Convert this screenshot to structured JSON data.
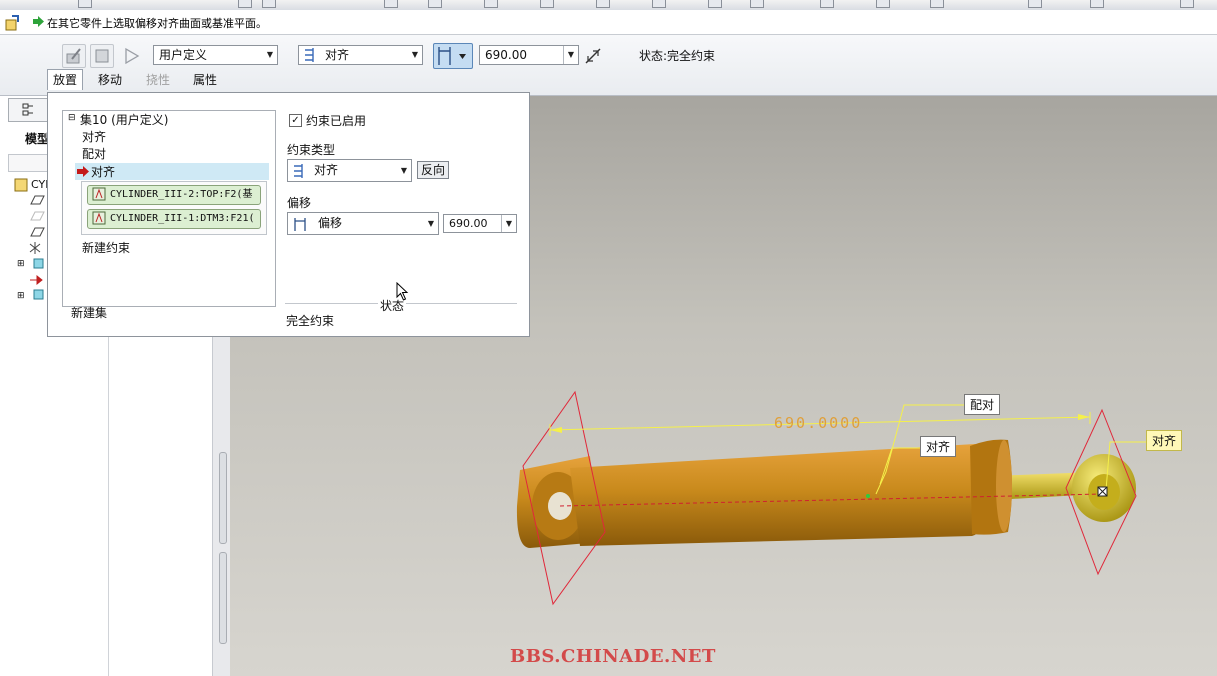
{
  "message": {
    "text": "在其它零件上选取偏移对齐曲面或基准平面。"
  },
  "dashboard": {
    "set_type": "用户定义",
    "constraint_type": "对齐",
    "offset_value": "690.00",
    "status": "状态:完全约束",
    "tabs": [
      {
        "label": "放置",
        "state": "active"
      },
      {
        "label": "移动",
        "state": "normal"
      },
      {
        "label": "挠性",
        "state": "disabled"
      },
      {
        "label": "属性",
        "state": "normal"
      }
    ]
  },
  "left_panel": {
    "tab_label": "模型",
    "root_item": "CYL"
  },
  "placement": {
    "tree": {
      "set_label": "集10 (用户定义)",
      "items": [
        "对齐",
        "配对",
        "对齐"
      ],
      "refs": [
        "CYLINDER_III-2:TOP:F2(基",
        "CYLINDER_III-1:DTM3:F21("
      ],
      "new_constraint": "新建约束",
      "new_set": "新建集"
    },
    "enabled_label": "约束已启用",
    "enabled": true,
    "constraint_type_label": "约束类型",
    "constraint_type_value": "对齐",
    "flip_button": "反向",
    "offset_label": "偏移",
    "offset_type_value": "偏移",
    "offset_value": "690.00",
    "status_label": "状态",
    "status_value": "完全约束"
  },
  "viewport": {
    "dimension": "690.0000",
    "annotations": [
      "配对",
      "对齐",
      "对齐"
    ]
  },
  "watermark": "BBS.CHINADE.NET",
  "colors": {
    "cylinder": "#c98a1c",
    "rod": "#d9c21d",
    "datum_plane": "#e0283a",
    "dimension_line": "#f5f04a",
    "selected_row": "#cfe9f5",
    "watermark": "#d34a4a"
  }
}
